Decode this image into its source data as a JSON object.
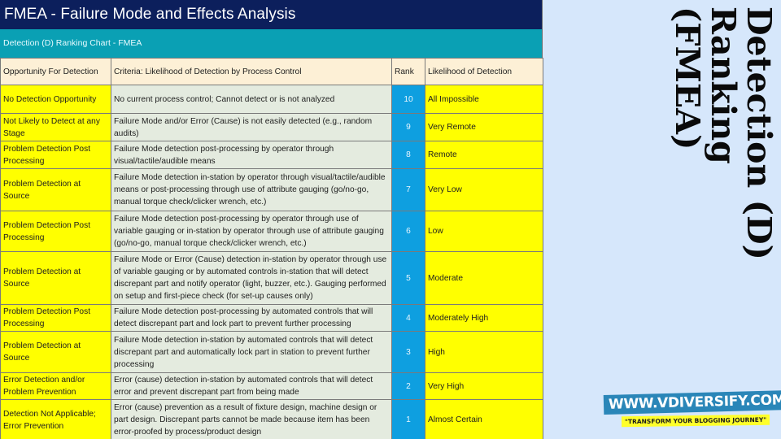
{
  "page": {
    "title": "FMEA - Failure Mode and Effects Analysis",
    "subtitle": "Detection (D) Ranking Chart - FMEA",
    "side_title": "Detection (D) Ranking (FMEA)",
    "colors": {
      "title_bg": "#0c1f5c",
      "subtitle_bg": "#0aa0b4",
      "header_bg": "#fdf0d6",
      "highlight_yellow": "#ffff00",
      "criteria_bg": "#e4ebdf",
      "rank_bg": "#0e9fe0",
      "page_bg": "#d6e7fb"
    }
  },
  "table": {
    "headers": [
      "Opportunity For Detection",
      "Criteria: Likelihood of Detection by Process Control",
      "Rank",
      "Likelihood of Detection"
    ],
    "rows": [
      {
        "opportunity": "No Detection Opportunity",
        "criteria": "No current process control; Cannot detect or is not analyzed",
        "rank": "10",
        "likelihood": "All Impossible"
      },
      {
        "opportunity": "Not Likely to Detect at any Stage",
        "criteria": "Failure Mode and/or Error (Cause) is not easily detected (e.g., random audits)",
        "rank": "9",
        "likelihood": "Very Remote"
      },
      {
        "opportunity": "Problem Detection Post Processing",
        "criteria": "Failure Mode detection post-processing by operator through visual/tactile/audible means",
        "rank": "8",
        "likelihood": "Remote"
      },
      {
        "opportunity": "Problem Detection at Source",
        "criteria": "Failure Mode detection in-station by operator through visual/tactile/audible means or post-processing through use of attribute gauging (go/no-go, manual torque check/clicker wrench, etc.)",
        "rank": "7",
        "likelihood": "Very Low"
      },
      {
        "opportunity": "Problem Detection Post Processing",
        "criteria": "Failure Mode detection post-processing by operator through use of variable gauging or in-station by operator through use of attribute gauging (go/no-go, manual torque check/clicker wrench, etc.)",
        "rank": "6",
        "likelihood": "Low"
      },
      {
        "opportunity": "Problem Detection at Source",
        "criteria": "Failure Mode or Error (Cause) detection in-station by operator through use of variable gauging or by automated controls in-station that will detect discrepant part and notify operator (light, buzzer, etc.). Gauging performed on setup and first-piece check (for set-up causes only)",
        "rank": "5",
        "likelihood": "Moderate"
      },
      {
        "opportunity": "Problem Detection Post Processing",
        "criteria": "Failure Mode detection post-processing by automated controls that will detect discrepant part and lock part to prevent further processing",
        "rank": "4",
        "likelihood": "Moderately High"
      },
      {
        "opportunity": "Problem Detection at Source",
        "criteria": "Failure Mode detection in-station by automated controls that will detect discrepant part and automatically lock part in station to prevent further processing",
        "rank": "3",
        "likelihood": "High"
      },
      {
        "opportunity": "Error Detection and/or Problem Prevention",
        "criteria": "Error (cause) detection in-station by automated controls that will detect error and prevent discrepant part from being made",
        "rank": "2",
        "likelihood": "Very High"
      },
      {
        "opportunity": "Detection Not Applicable; Error Prevention",
        "criteria": "Error (cause) prevention as a result of fixture design, machine design or part design. Discrepant parts cannot be made because item has been error-proofed by process/product design",
        "rank": "1",
        "likelihood": "Almost Certain"
      }
    ]
  },
  "brand": {
    "url": "WWW.VDIVERSIFY.COM",
    "tagline": "\"TRANSFORM YOUR BLOGGING JOURNEY\""
  }
}
